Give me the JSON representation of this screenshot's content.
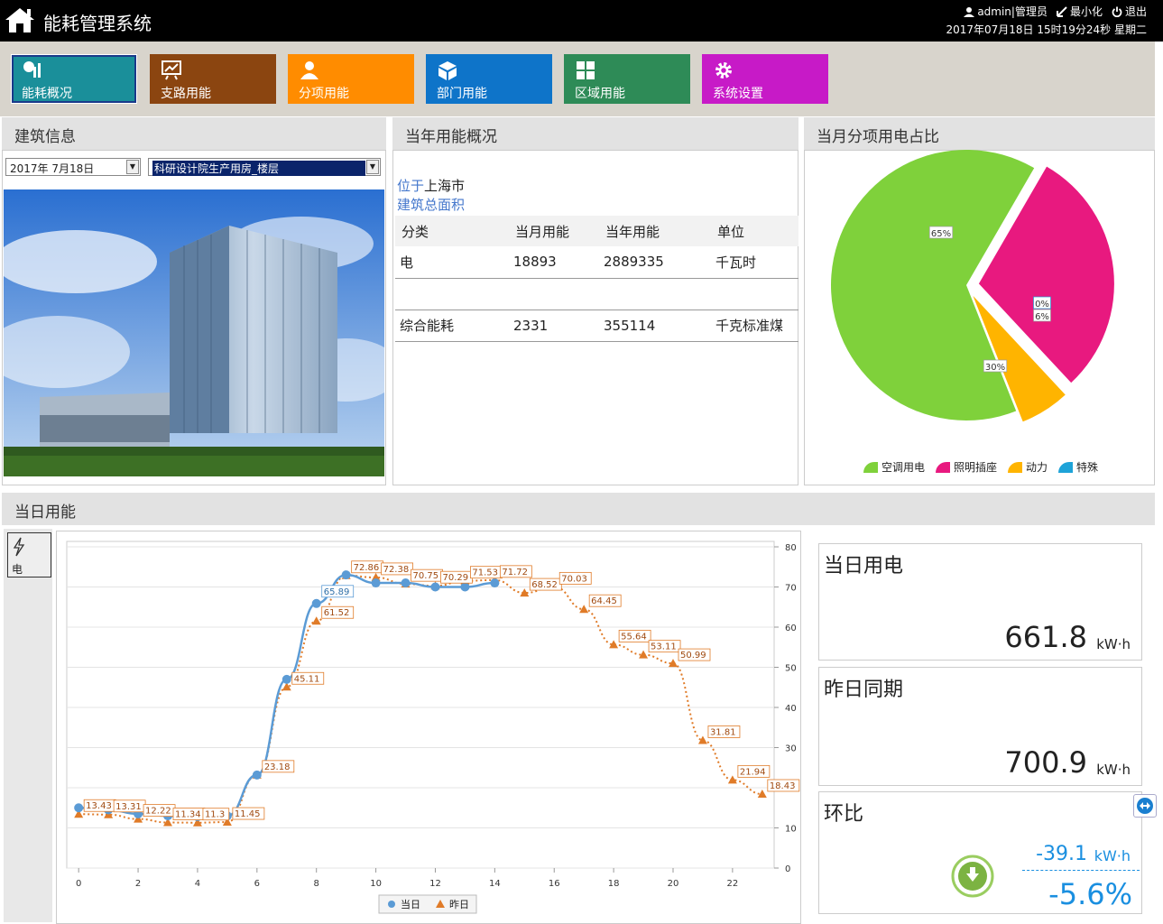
{
  "header": {
    "app_title": "能耗管理系统",
    "user": "admin|管理员",
    "minimize": "最小化",
    "logout": "退出",
    "datetime": "2017年07月18日 15时19分24秒 星期二"
  },
  "nav": [
    {
      "label": "能耗概况",
      "color": "#1a8f9a",
      "icon": "overview-icon"
    },
    {
      "label": "支路用能",
      "color": "#8b4510",
      "icon": "trend-chart-icon"
    },
    {
      "label": "分项用能",
      "color": "#ff8c00",
      "icon": "user-icon"
    },
    {
      "label": "部门用能",
      "color": "#0e74c9",
      "icon": "cube-icon"
    },
    {
      "label": "区域用能",
      "color": "#2e8b57",
      "icon": "grid-icon"
    },
    {
      "label": "系统设置",
      "color": "#c71ac7",
      "icon": "gear-icon"
    }
  ],
  "building": {
    "title": "建筑信息",
    "date_value": "2017年  7月18日",
    "building_select": "科研设计院生产用房_楼层"
  },
  "yearly": {
    "title": "当年用能概况",
    "location_label": "位于",
    "location_value": "上海市",
    "area_label": "建筑总面积",
    "columns": [
      "分类",
      "当月用能",
      "当年用能",
      "单位"
    ],
    "rows": [
      [
        "电",
        "18893",
        "2889335",
        "千瓦时"
      ],
      [
        "",
        "",
        "",
        ""
      ],
      [
        "综合能耗",
        "2331",
        "355114",
        "千克标准煤"
      ]
    ]
  },
  "pie": {
    "title": "当月分项用电占比",
    "slices": [
      {
        "name": "空调用电",
        "value": 65,
        "label": "65%",
        "color": "#7fd13b"
      },
      {
        "name": "照明插座",
        "value": 30,
        "label": "30%",
        "color": "#e8197f"
      },
      {
        "name": "动力",
        "value": 6,
        "label": "6%",
        "color": "#ffb400"
      },
      {
        "name": "特殊",
        "value": 0,
        "label": "0%",
        "color": "#1ea3d8"
      }
    ]
  },
  "daily": {
    "title": "当日用能",
    "side_tab": "电",
    "stats": {
      "today_label": "当日用电",
      "today_value": "661.8",
      "yesterday_label": "昨日同期",
      "yesterday_value": "700.9",
      "ratio_label": "环比",
      "diff_value": "-39.1",
      "ratio_value": "-5.6%",
      "unit": "kW·h"
    }
  },
  "chart_data": {
    "type": "line",
    "x_ticks": [
      0,
      2,
      4,
      6,
      8,
      10,
      12,
      14,
      16,
      18,
      20,
      22
    ],
    "ylim": [
      0,
      80
    ],
    "y_ticks": [
      0,
      10,
      20,
      30,
      40,
      50,
      60,
      70,
      80
    ],
    "series": [
      {
        "name": "当日",
        "color": "#5b9bd5",
        "x": [
          0,
          1,
          2,
          3,
          4,
          5,
          6,
          7,
          8,
          9,
          10,
          11,
          12,
          13,
          14
        ],
        "values": [
          15.0,
          14.5,
          13.5,
          13.0,
          12.8,
          13.0,
          23.18,
          47.0,
          65.89,
          73.0,
          71.0,
          71.0,
          70.0,
          70.0,
          71.0
        ],
        "labels": {
          "8": "65.89"
        }
      },
      {
        "name": "昨日",
        "color": "#e07b28",
        "x": [
          0,
          1,
          2,
          3,
          4,
          5,
          6,
          7,
          8,
          9,
          10,
          11,
          12,
          13,
          14,
          15,
          16,
          17,
          18,
          19,
          20,
          21,
          22,
          23
        ],
        "values": [
          13.43,
          13.31,
          12.22,
          11.34,
          11.3,
          11.45,
          23.18,
          45.11,
          61.52,
          72.86,
          72.38,
          70.75,
          70.29,
          71.53,
          71.72,
          68.52,
          70.03,
          64.45,
          55.64,
          53.11,
          50.99,
          31.81,
          21.94,
          18.43
        ],
        "labels": {
          "0": "13.43",
          "1": "13.31",
          "2": "12.22",
          "3": "11.34",
          "4": "11.3",
          "5": "11.45",
          "6": "23.18",
          "7": "45.11",
          "8": "61.52",
          "9": "72.86",
          "10": "72.38",
          "11": "70.75",
          "12": "70.29",
          "13": "71.53",
          "14": "71.72",
          "15": "68.52",
          "16": "70.03",
          "17": "64.45",
          "18": "55.64",
          "19": "53.11",
          "20": "50.99",
          "21": "31.81",
          "22": "21.94",
          "23": "18.43"
        }
      }
    ],
    "legend": [
      "当日",
      "昨日"
    ]
  }
}
